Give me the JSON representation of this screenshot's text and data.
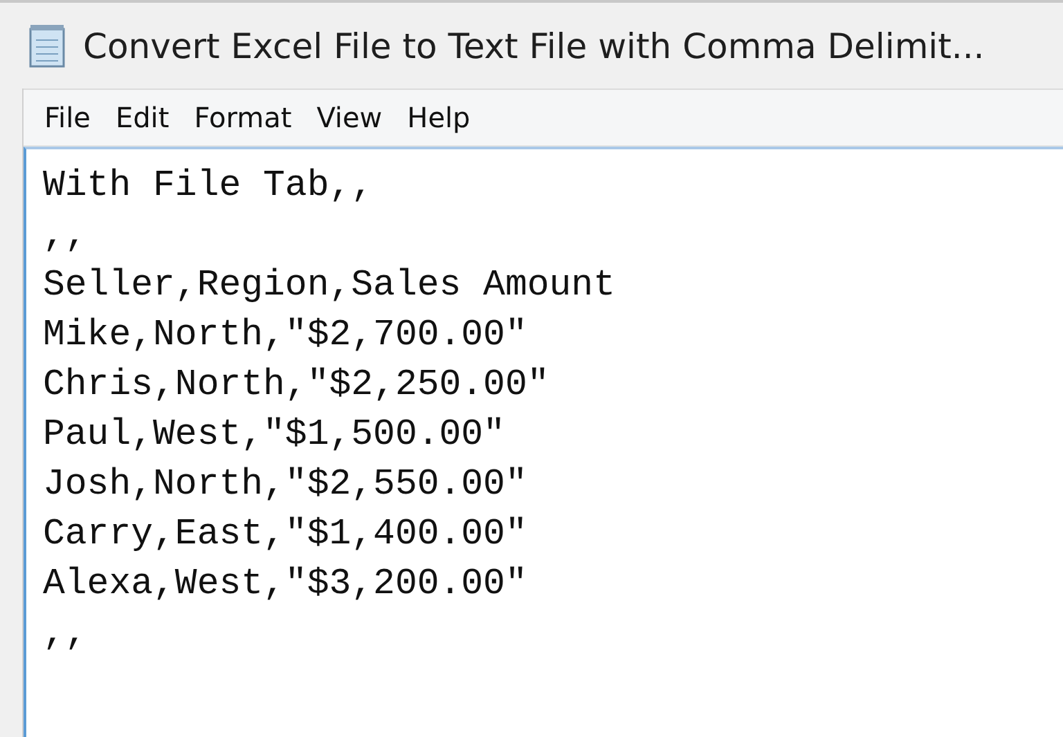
{
  "window": {
    "title": "Convert Excel File to Text File with Comma Delimit..."
  },
  "menu": [
    "File",
    "Edit",
    "Format",
    "View",
    "Help"
  ],
  "editor": {
    "lines": [
      "With File Tab,,",
      ",,",
      "Seller,Region,Sales Amount",
      "Mike,North,\"$2,700.00\"",
      "Chris,North,\"$2,250.00\"",
      "Paul,West,\"$1,500.00\"",
      "Josh,North,\"$2,550.00\"",
      "Carry,East,\"$1,400.00\"",
      "Alexa,West,\"$3,200.00\"",
      ",,"
    ]
  }
}
